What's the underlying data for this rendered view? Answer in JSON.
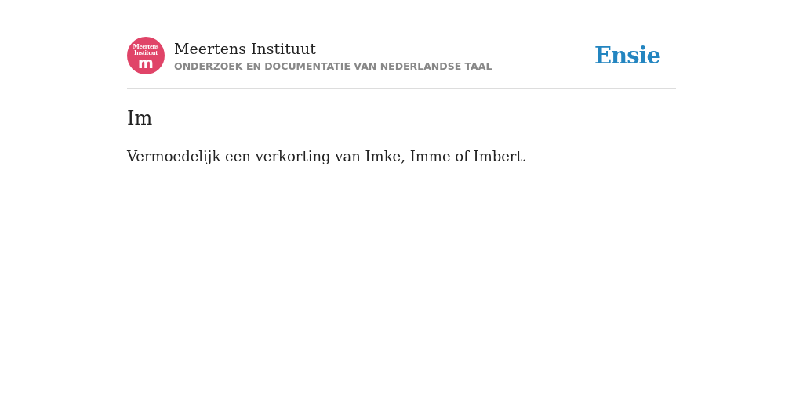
{
  "header": {
    "logo": {
      "line_1": "Meertens",
      "line_2": "Instituut",
      "letter": "m"
    },
    "title": "Meertens Instituut",
    "subtitle": "ONDERZOEK EN DOCUMENTATIE VAN NEDERLANDSE TAAL",
    "brand": "Ensie"
  },
  "entry": {
    "heading": "Im",
    "text": "Vermoedelijk een verkorting van Imke, Imme of Imbert."
  }
}
